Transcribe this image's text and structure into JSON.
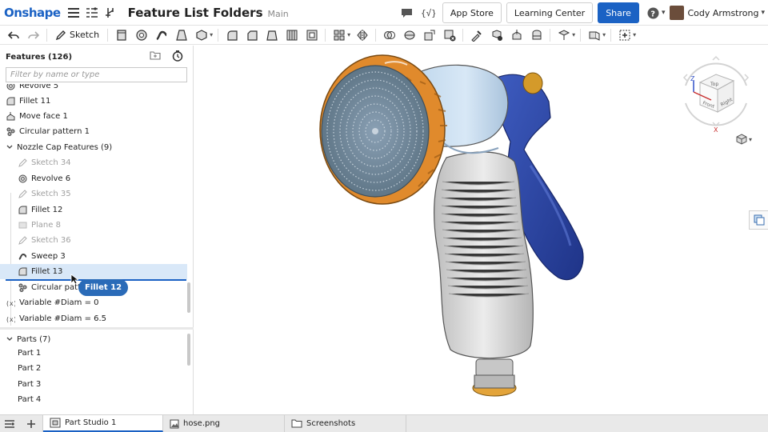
{
  "app": {
    "logo": "Onshape",
    "doc_title": "Feature List Folders",
    "branch": "Main"
  },
  "topbar": {
    "app_store": "App Store",
    "learning_center": "Learning Center",
    "share": "Share",
    "user_name": "Cody Armstrong",
    "help_caret": "▾",
    "user_caret": "▾"
  },
  "toolbar": {
    "sketch_label": "Sketch"
  },
  "features": {
    "header": "Features (126)",
    "filter_placeholder": "Filter by name or type",
    "items": [
      {
        "label": "Revolve 5",
        "icon": "revolve-icon",
        "dim": false,
        "child": false
      },
      {
        "label": "Fillet 11",
        "icon": "fillet-icon",
        "dim": false,
        "child": false
      },
      {
        "label": "Move face 1",
        "icon": "move-face-icon",
        "dim": false,
        "child": false
      },
      {
        "label": "Circular pattern 1",
        "icon": "circular-pattern-icon",
        "dim": false,
        "child": false
      },
      {
        "label": "Nozzle Cap Features (9)",
        "icon": "folder-caret",
        "dim": false,
        "child": false
      },
      {
        "label": "Sketch 34",
        "icon": "sketch-icon",
        "dim": true,
        "child": true
      },
      {
        "label": "Revolve 6",
        "icon": "revolve-icon",
        "dim": false,
        "child": true
      },
      {
        "label": "Sketch 35",
        "icon": "sketch-icon",
        "dim": true,
        "child": true
      },
      {
        "label": "Fillet 12",
        "icon": "fillet-icon",
        "dim": false,
        "child": true
      },
      {
        "label": "Plane 8",
        "icon": "plane-icon",
        "dim": true,
        "child": true
      },
      {
        "label": "Sketch 36",
        "icon": "sketch-icon",
        "dim": true,
        "child": true
      },
      {
        "label": "Sweep 3",
        "icon": "sweep-icon",
        "dim": false,
        "child": true
      },
      {
        "label": "Fillet 13",
        "icon": "fillet-icon",
        "dim": false,
        "child": true
      },
      {
        "label": "Circular patte",
        "icon": "circular-pattern-icon",
        "dim": false,
        "child": true
      }
    ],
    "drag_tooltip": "Fillet 12",
    "variables": [
      {
        "label": "Variable #Diam = 0"
      },
      {
        "label": "Variable #Diam = 6.5"
      }
    ]
  },
  "parts": {
    "header": "Parts (7)",
    "items": [
      "Part 1",
      "Part 2",
      "Part 3",
      "Part 4"
    ]
  },
  "viewcube": {
    "top": "Top",
    "front": "Front",
    "right": "Right",
    "axis_x": "X",
    "axis_z": "Z"
  },
  "tabs": [
    {
      "label": "Part Studio 1",
      "icon": "part-studio-icon",
      "active": true
    },
    {
      "label": "hose.png",
      "icon": "image-icon",
      "active": false
    },
    {
      "label": "Screenshots",
      "icon": "folder-icon",
      "active": false
    }
  ],
  "colors": {
    "accent": "#1b62c4",
    "nozzle_orange": "#e08a2c",
    "trigger_blue": "#2c48a6",
    "head_lightblue": "#c9dff2",
    "grip_gray": "#d7d7d7",
    "selection": "#d9e8f8"
  }
}
